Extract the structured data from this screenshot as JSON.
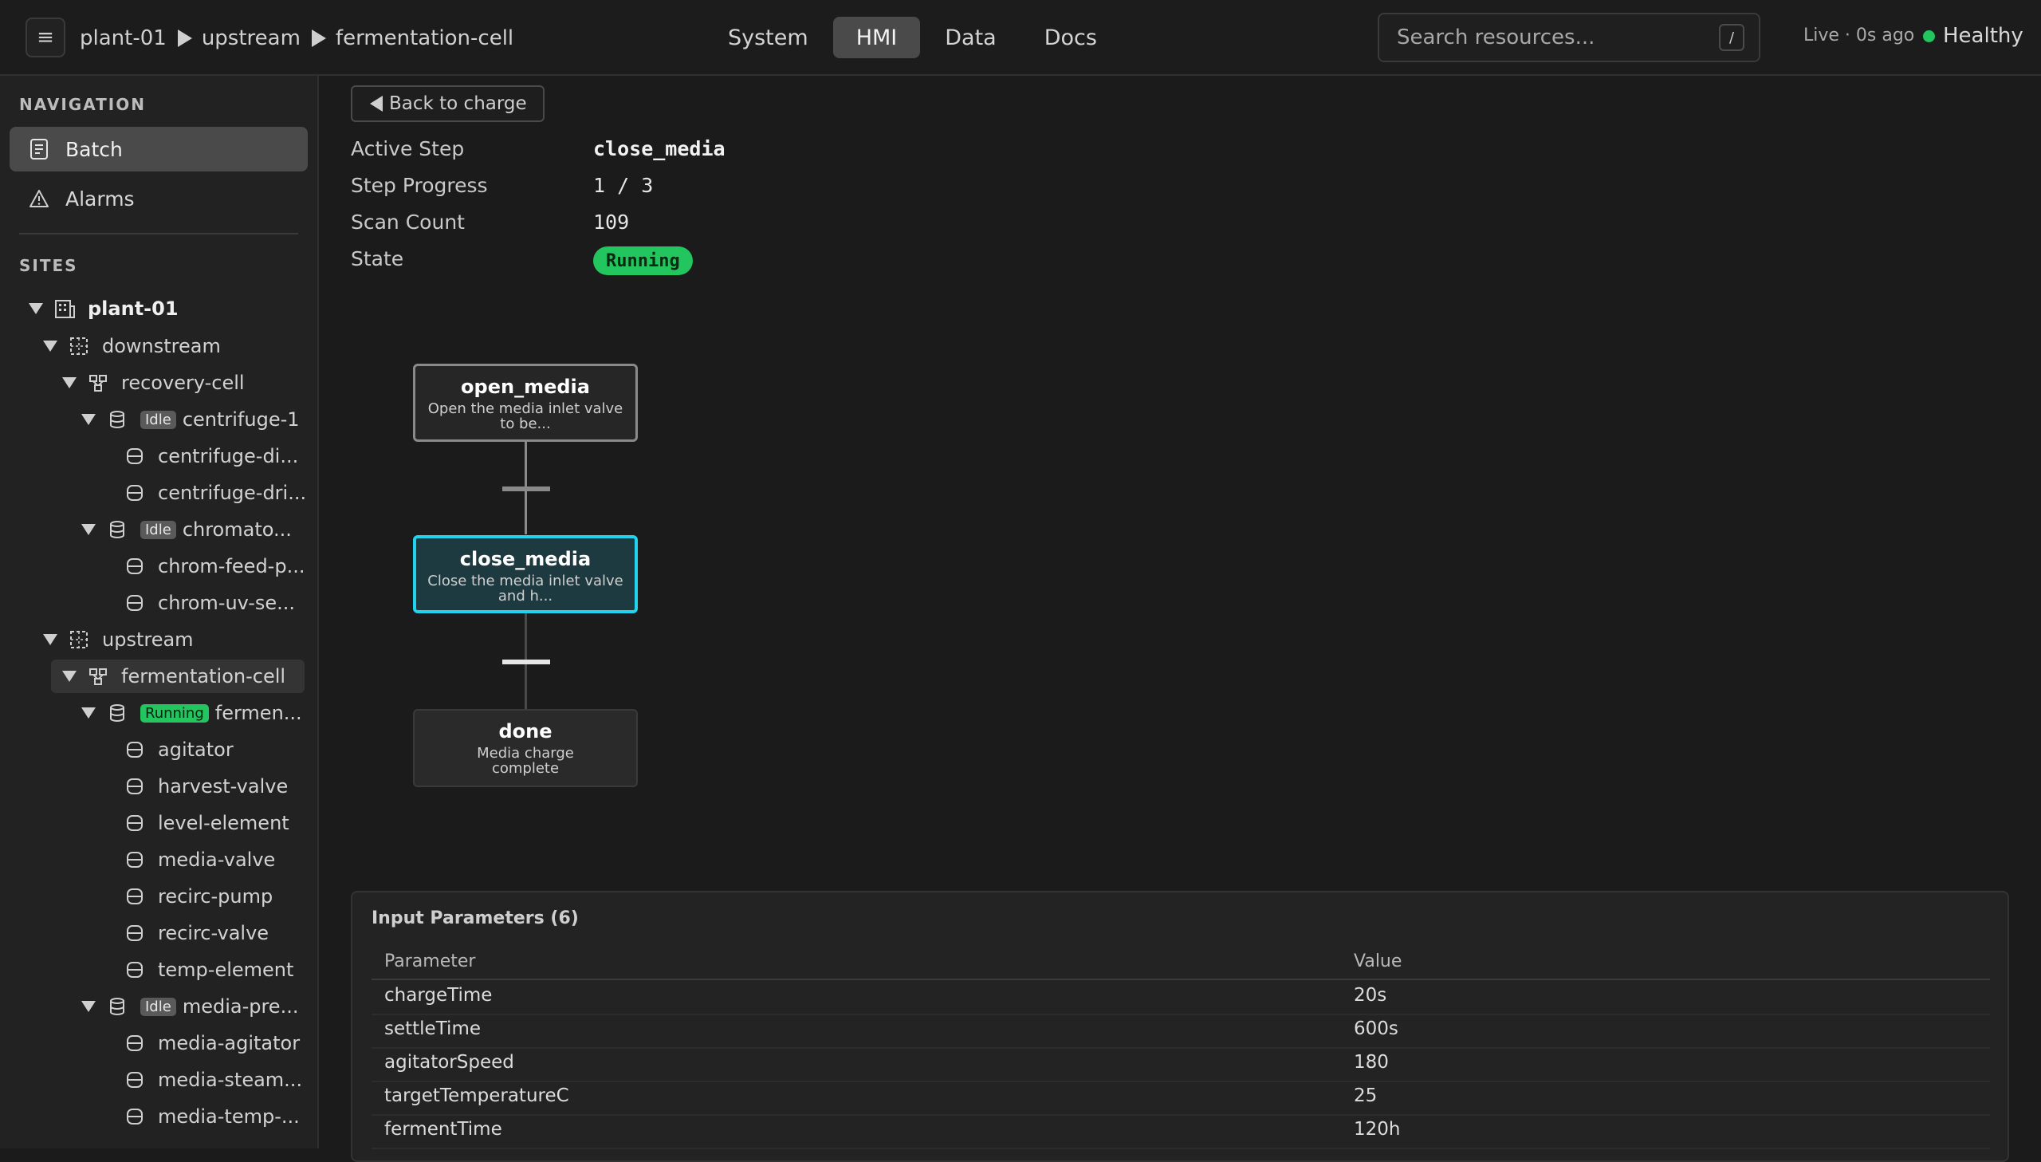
{
  "topbar": {
    "breadcrumb": [
      "plant-01",
      "upstream",
      "fermentation-cell"
    ],
    "tabs": [
      {
        "label": "System",
        "active": false
      },
      {
        "label": "HMI",
        "active": true
      },
      {
        "label": "Data",
        "active": false
      },
      {
        "label": "Docs",
        "active": false
      }
    ],
    "search_placeholder": "Search resources...",
    "search_shortcut": "/",
    "live_status": "Live · 0s ago",
    "health": "Healthy"
  },
  "sidebar": {
    "nav_title": "NAVIGATION",
    "nav_items": [
      {
        "label": "Batch",
        "icon": "document-icon",
        "active": true
      },
      {
        "label": "Alarms",
        "icon": "warning-icon",
        "active": false
      }
    ],
    "sites_title": "SITES",
    "tree": [
      {
        "label": "plant-01",
        "level": 0,
        "icon": "building-icon",
        "expanded": true,
        "bold": true
      },
      {
        "label": "downstream",
        "level": 1,
        "icon": "area-icon",
        "expanded": true
      },
      {
        "label": "recovery-cell",
        "level": 2,
        "icon": "cell-icon",
        "expanded": true
      },
      {
        "label": "centrifuge-1",
        "level": 3,
        "icon": "unit-icon",
        "expanded": true,
        "badge": "Idle"
      },
      {
        "label": "centrifuge-di...",
        "level": 4,
        "icon": "equipment-icon"
      },
      {
        "label": "centrifuge-dri...",
        "level": 4,
        "icon": "equipment-icon"
      },
      {
        "label": "chromato...",
        "level": 3,
        "icon": "unit-icon",
        "expanded": true,
        "badge": "Idle"
      },
      {
        "label": "chrom-feed-p...",
        "level": 4,
        "icon": "equipment-icon"
      },
      {
        "label": "chrom-uv-se...",
        "level": 4,
        "icon": "equipment-icon"
      },
      {
        "label": "upstream",
        "level": 1,
        "icon": "area-icon",
        "expanded": true
      },
      {
        "label": "fermentation-cell",
        "level": 2,
        "icon": "cell-icon",
        "expanded": true,
        "selected": true
      },
      {
        "label": "fermen...",
        "level": 3,
        "icon": "unit-icon",
        "expanded": true,
        "badge": "Running"
      },
      {
        "label": "agitator",
        "level": 4,
        "icon": "equipment-icon"
      },
      {
        "label": "harvest-valve",
        "level": 4,
        "icon": "equipment-icon"
      },
      {
        "label": "level-element",
        "level": 4,
        "icon": "equipment-icon"
      },
      {
        "label": "media-valve",
        "level": 4,
        "icon": "equipment-icon"
      },
      {
        "label": "recirc-pump",
        "level": 4,
        "icon": "equipment-icon"
      },
      {
        "label": "recirc-valve",
        "level": 4,
        "icon": "equipment-icon"
      },
      {
        "label": "temp-element",
        "level": 4,
        "icon": "equipment-icon"
      },
      {
        "label": "media-pre...",
        "level": 3,
        "icon": "unit-icon",
        "expanded": true,
        "badge": "Idle"
      },
      {
        "label": "media-agitator",
        "level": 4,
        "icon": "equipment-icon"
      },
      {
        "label": "media-steam...",
        "level": 4,
        "icon": "equipment-icon"
      },
      {
        "label": "media-temp-...",
        "level": 4,
        "icon": "equipment-icon"
      }
    ]
  },
  "main": {
    "back_label": "Back to charge",
    "details": [
      {
        "label": "Active Step",
        "value": "close_media"
      },
      {
        "label": "Step Progress",
        "value": "1 / 3"
      },
      {
        "label": "Scan Count",
        "value": "109"
      },
      {
        "label": "State",
        "value": "Running"
      }
    ],
    "steps": [
      {
        "name": "open_media",
        "desc": "Open the media inlet valve to be...",
        "status": "done"
      },
      {
        "name": "close_media",
        "desc": "Close the media inlet valve and h...",
        "status": "active"
      },
      {
        "name": "done",
        "desc": "Media charge complete",
        "status": "pending"
      }
    ],
    "params": {
      "title": "Input Parameters (6)",
      "col_param": "Parameter",
      "col_value": "Value",
      "rows": [
        {
          "name": "chargeTime",
          "value": "20s"
        },
        {
          "name": "settleTime",
          "value": "600s"
        },
        {
          "name": "agitatorSpeed",
          "value": "180"
        },
        {
          "name": "targetTemperatureC",
          "value": "25"
        },
        {
          "name": "fermentTime",
          "value": "120h"
        }
      ]
    }
  },
  "colors": {
    "accent_active_step": "#22d3ee",
    "running": "#22c55e",
    "idle_badge": "#5a5a5a"
  }
}
